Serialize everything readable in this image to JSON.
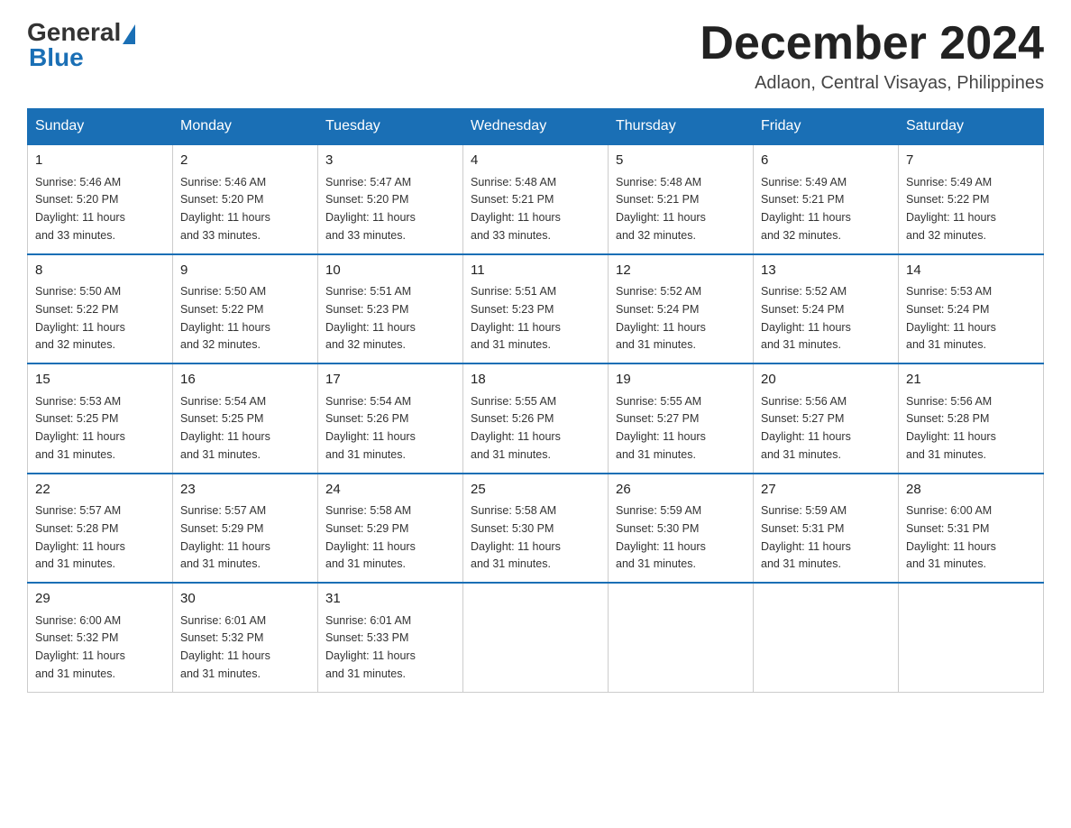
{
  "header": {
    "logo_general": "General",
    "logo_blue": "Blue",
    "month_title": "December 2024",
    "location": "Adlaon, Central Visayas, Philippines"
  },
  "weekdays": [
    "Sunday",
    "Monday",
    "Tuesday",
    "Wednesday",
    "Thursday",
    "Friday",
    "Saturday"
  ],
  "weeks": [
    [
      {
        "day": "1",
        "sunrise": "5:46 AM",
        "sunset": "5:20 PM",
        "daylight": "11 hours and 33 minutes."
      },
      {
        "day": "2",
        "sunrise": "5:46 AM",
        "sunset": "5:20 PM",
        "daylight": "11 hours and 33 minutes."
      },
      {
        "day": "3",
        "sunrise": "5:47 AM",
        "sunset": "5:20 PM",
        "daylight": "11 hours and 33 minutes."
      },
      {
        "day": "4",
        "sunrise": "5:48 AM",
        "sunset": "5:21 PM",
        "daylight": "11 hours and 33 minutes."
      },
      {
        "day": "5",
        "sunrise": "5:48 AM",
        "sunset": "5:21 PM",
        "daylight": "11 hours and 32 minutes."
      },
      {
        "day": "6",
        "sunrise": "5:49 AM",
        "sunset": "5:21 PM",
        "daylight": "11 hours and 32 minutes."
      },
      {
        "day": "7",
        "sunrise": "5:49 AM",
        "sunset": "5:22 PM",
        "daylight": "11 hours and 32 minutes."
      }
    ],
    [
      {
        "day": "8",
        "sunrise": "5:50 AM",
        "sunset": "5:22 PM",
        "daylight": "11 hours and 32 minutes."
      },
      {
        "day": "9",
        "sunrise": "5:50 AM",
        "sunset": "5:22 PM",
        "daylight": "11 hours and 32 minutes."
      },
      {
        "day": "10",
        "sunrise": "5:51 AM",
        "sunset": "5:23 PM",
        "daylight": "11 hours and 32 minutes."
      },
      {
        "day": "11",
        "sunrise": "5:51 AM",
        "sunset": "5:23 PM",
        "daylight": "11 hours and 31 minutes."
      },
      {
        "day": "12",
        "sunrise": "5:52 AM",
        "sunset": "5:24 PM",
        "daylight": "11 hours and 31 minutes."
      },
      {
        "day": "13",
        "sunrise": "5:52 AM",
        "sunset": "5:24 PM",
        "daylight": "11 hours and 31 minutes."
      },
      {
        "day": "14",
        "sunrise": "5:53 AM",
        "sunset": "5:24 PM",
        "daylight": "11 hours and 31 minutes."
      }
    ],
    [
      {
        "day": "15",
        "sunrise": "5:53 AM",
        "sunset": "5:25 PM",
        "daylight": "11 hours and 31 minutes."
      },
      {
        "day": "16",
        "sunrise": "5:54 AM",
        "sunset": "5:25 PM",
        "daylight": "11 hours and 31 minutes."
      },
      {
        "day": "17",
        "sunrise": "5:54 AM",
        "sunset": "5:26 PM",
        "daylight": "11 hours and 31 minutes."
      },
      {
        "day": "18",
        "sunrise": "5:55 AM",
        "sunset": "5:26 PM",
        "daylight": "11 hours and 31 minutes."
      },
      {
        "day": "19",
        "sunrise": "5:55 AM",
        "sunset": "5:27 PM",
        "daylight": "11 hours and 31 minutes."
      },
      {
        "day": "20",
        "sunrise": "5:56 AM",
        "sunset": "5:27 PM",
        "daylight": "11 hours and 31 minutes."
      },
      {
        "day": "21",
        "sunrise": "5:56 AM",
        "sunset": "5:28 PM",
        "daylight": "11 hours and 31 minutes."
      }
    ],
    [
      {
        "day": "22",
        "sunrise": "5:57 AM",
        "sunset": "5:28 PM",
        "daylight": "11 hours and 31 minutes."
      },
      {
        "day": "23",
        "sunrise": "5:57 AM",
        "sunset": "5:29 PM",
        "daylight": "11 hours and 31 minutes."
      },
      {
        "day": "24",
        "sunrise": "5:58 AM",
        "sunset": "5:29 PM",
        "daylight": "11 hours and 31 minutes."
      },
      {
        "day": "25",
        "sunrise": "5:58 AM",
        "sunset": "5:30 PM",
        "daylight": "11 hours and 31 minutes."
      },
      {
        "day": "26",
        "sunrise": "5:59 AM",
        "sunset": "5:30 PM",
        "daylight": "11 hours and 31 minutes."
      },
      {
        "day": "27",
        "sunrise": "5:59 AM",
        "sunset": "5:31 PM",
        "daylight": "11 hours and 31 minutes."
      },
      {
        "day": "28",
        "sunrise": "6:00 AM",
        "sunset": "5:31 PM",
        "daylight": "11 hours and 31 minutes."
      }
    ],
    [
      {
        "day": "29",
        "sunrise": "6:00 AM",
        "sunset": "5:32 PM",
        "daylight": "11 hours and 31 minutes."
      },
      {
        "day": "30",
        "sunrise": "6:01 AM",
        "sunset": "5:32 PM",
        "daylight": "11 hours and 31 minutes."
      },
      {
        "day": "31",
        "sunrise": "6:01 AM",
        "sunset": "5:33 PM",
        "daylight": "11 hours and 31 minutes."
      },
      null,
      null,
      null,
      null
    ]
  ],
  "labels": {
    "sunrise": "Sunrise:",
    "sunset": "Sunset:",
    "daylight": "Daylight:"
  }
}
